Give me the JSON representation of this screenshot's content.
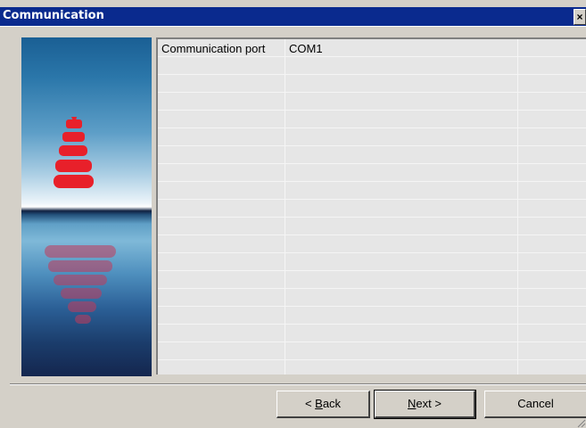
{
  "window": {
    "title": "Communication",
    "close_glyph": "×"
  },
  "grid": {
    "rows": [
      {
        "label": "Communication port",
        "value": "COM1",
        "extra": ""
      }
    ],
    "empty_row_count": 19
  },
  "buttons": {
    "back_label": "< Back",
    "back_mnemonic": "B",
    "next_label": "Next >",
    "next_mnemonic": "N",
    "cancel_label": "Cancel"
  },
  "side_image": {
    "icon": "red-beacon-logo-icon",
    "colors": {
      "logo": "#e8202a",
      "sky_top": "#1a5f94",
      "horizon": "#0f2040"
    }
  }
}
